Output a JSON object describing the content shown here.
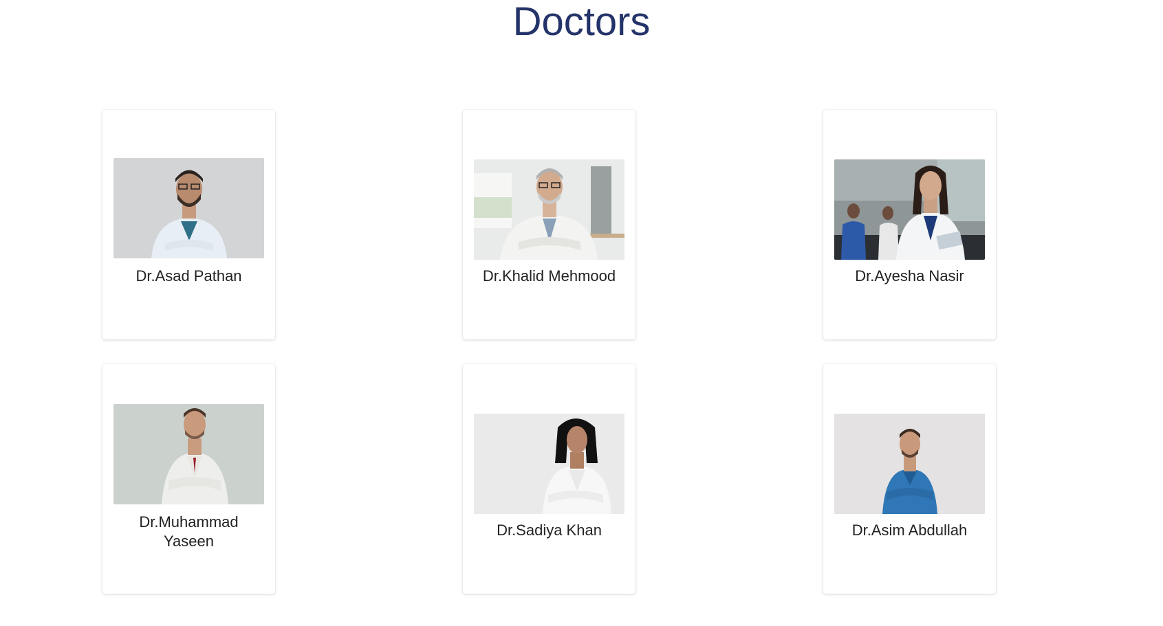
{
  "page": {
    "title": "Doctors"
  },
  "doctors": [
    {
      "name": "Dr.Asad Pathan",
      "photo_icon": "doctor-photo-icon"
    },
    {
      "name": "Dr.Khalid Mehmood",
      "photo_icon": "doctor-photo-icon"
    },
    {
      "name": "Dr.Ayesha Nasir",
      "photo_icon": "doctor-photo-icon"
    },
    {
      "name": "Dr.Muhammad Yaseen",
      "photo_icon": "doctor-photo-icon"
    },
    {
      "name": "Dr.Sadiya Khan",
      "photo_icon": "doctor-photo-icon"
    },
    {
      "name": "Dr.Asim Abdullah",
      "photo_icon": "doctor-photo-icon"
    }
  ],
  "colors": {
    "title": "#24346a",
    "name_text": "#222222",
    "card_bg": "#ffffff"
  }
}
